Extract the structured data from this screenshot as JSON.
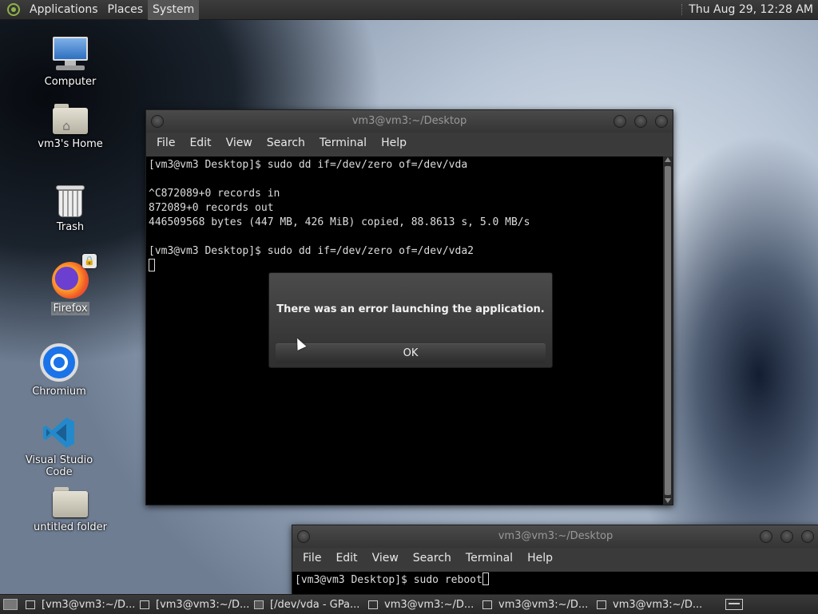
{
  "top_panel": {
    "menus": [
      "Applications",
      "Places",
      "System"
    ],
    "clock": "Thu Aug 29, 12:28 AM"
  },
  "desktop_icons": [
    {
      "label": "Computer",
      "icon": "computer-icon"
    },
    {
      "label": "vm3's Home",
      "icon": "home-folder-icon"
    },
    {
      "label": "Trash",
      "icon": "trash-icon"
    },
    {
      "label": "Firefox",
      "icon": "firefox-icon"
    },
    {
      "label": "Chromium",
      "icon": "chromium-icon"
    },
    {
      "label": "Visual Studio Code",
      "icon": "vscode-icon"
    },
    {
      "label": "untitled folder",
      "icon": "folder-icon"
    }
  ],
  "terminal_main": {
    "title": "vm3@vm3:~/Desktop",
    "menu": [
      "File",
      "Edit",
      "View",
      "Search",
      "Terminal",
      "Help"
    ],
    "lines": [
      "[vm3@vm3 Desktop]$ sudo dd if=/dev/zero of=/dev/vda",
      "",
      "^C872089+0 records in",
      "872089+0 records out",
      "446509568 bytes (447 MB, 426 MiB) copied, 88.8613 s, 5.0 MB/s",
      "",
      "[vm3@vm3 Desktop]$ sudo dd if=/dev/zero of=/dev/vda2"
    ]
  },
  "terminal_second": {
    "title": "vm3@vm3:~/Desktop",
    "menu": [
      "File",
      "Edit",
      "View",
      "Search",
      "Terminal",
      "Help"
    ],
    "prompt_line": "[vm3@vm3 Desktop]$ sudo reboot"
  },
  "error_dialog": {
    "message": "There was an error launching the application.",
    "ok_label": "OK"
  },
  "taskbar": {
    "tasks": [
      "[vm3@vm3:~/D...",
      "[vm3@vm3:~/D...",
      "[/dev/vda - GPa...",
      "vm3@vm3:~/D...",
      "vm3@vm3:~/D...",
      "vm3@vm3:~/D..."
    ]
  }
}
